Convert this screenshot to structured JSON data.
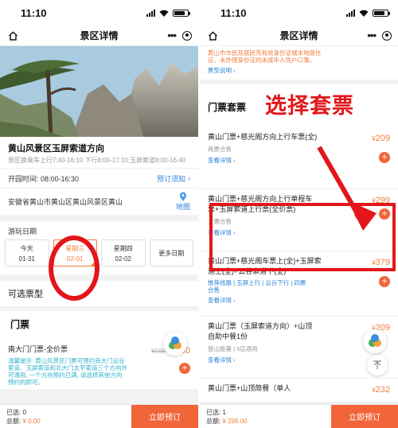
{
  "left": {
    "status": {
      "time": "11:10"
    },
    "nav": {
      "title": "景区详情"
    },
    "spot": {
      "name": "黄山风景区玉屏索道方向",
      "hours_desc": "景区换乘车上行7:40-16:10 下行8:00-17:10;玉屏索道8:00-16:40",
      "open_label": "开园时间: 08:00-16:30",
      "booking_notice": "预订须知",
      "address": "安徽省黄山市黄山区黄山风景区黄山",
      "map": "地图"
    },
    "date_section": {
      "label": "游玩日期",
      "dates": [
        {
          "day": "今天",
          "date": "01-31"
        },
        {
          "day": "星期三",
          "date": "02-01"
        },
        {
          "day": "星期四",
          "date": "02-02"
        }
      ],
      "more": "更多日期"
    },
    "ticket_section": {
      "subtitle": "可选票型",
      "head": "门票",
      "item": {
        "name": "南大门门票-全价票",
        "old_price": "¥190",
        "price_symbol": "¥",
        "price": "190",
        "notice": "温馨提示: 黄山风景区门票可预约南大门云谷索道、玉屏索道和北大门太平索道三个方向并可通用, 一个方向预约已满, 请选择其他方向预约的即可。"
      }
    },
    "bottom": {
      "selected": "已选: 0",
      "total_label": "总额:",
      "total": "¥ 0.00",
      "buy": "立即预订"
    }
  },
  "right": {
    "status": {
      "time": "11:10"
    },
    "nav": {
      "title": "景区详情"
    },
    "top_warning": "黄山市市民及居民凭有效身份证城本地居住证、未办理身份证的未成年人凭户口簿。",
    "top_link": "票型说明",
    "pkg_title": "门票套票",
    "annotation": "选择套票",
    "packages": [
      {
        "name": "黄山门票+慈光阁方向上行车票(全)",
        "meta": "两票合售",
        "detail": "查看详情",
        "price_symbol": "¥",
        "price": "209"
      },
      {
        "name": "黄山门票+慈光阁方向上行单程车票+玉屏索道上行票(全价票)",
        "meta": "三票合售",
        "detail": "查看详情",
        "price_symbol": "¥",
        "price": "299",
        "qty": "1"
      },
      {
        "name": "黄山门票+慈光阁车票上(全)+玉屏索道上(全)+云谷索道下(全)",
        "meta": "推荐线路 | 玉屏上行 | 云谷下行 | 四票合售",
        "detail": "查看详情",
        "price_symbol": "¥",
        "price": "379"
      },
      {
        "name": "黄山门票（玉屏索道方向）+山顶自助中餐1份",
        "meta": "登山能量 | 5店通用",
        "detail": "查看详情",
        "price_symbol": "¥",
        "price": "209"
      },
      {
        "name": "黄山门票+山顶简餐（单人",
        "price_symbol": "¥",
        "price": "232"
      }
    ],
    "bottom": {
      "selected": "已选: 1",
      "total_label": "总额:",
      "total": "¥ 299.00",
      "buy": "立即预订"
    }
  },
  "colors": {
    "accent": "#f2653a",
    "annotation_red": "#e3161b",
    "link_blue": "#2f86d6"
  }
}
